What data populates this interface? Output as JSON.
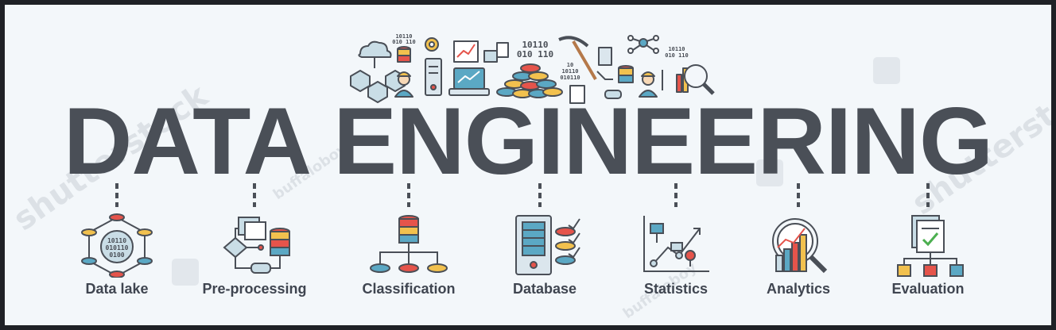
{
  "banner": {
    "title": "DATA ENGINEERING",
    "colors": {
      "title": "#4a4f57",
      "outline": "#4a4f57",
      "red": "#e5544b",
      "yellow": "#f2c14e",
      "teal": "#5ba8c4",
      "light_blue": "#c9dde6",
      "background": "#f3f7fa"
    },
    "items": [
      {
        "label": "Data lake",
        "icon": "data-lake-icon"
      },
      {
        "label": "Pre-processing",
        "icon": "pre-processing-icon"
      },
      {
        "label": "Classification",
        "icon": "classification-icon"
      },
      {
        "label": "Database",
        "icon": "database-icon"
      },
      {
        "label": "Statistics",
        "icon": "statistics-icon"
      },
      {
        "label": "Analytics",
        "icon": "analytics-icon"
      },
      {
        "label": "Evaluation",
        "icon": "evaluation-icon"
      }
    ],
    "hero_text": {
      "binary_small_1": "10110",
      "binary_small_2": "010 110",
      "binary_big_1": "10110",
      "binary_big_2": "010 110",
      "binary_mid_1": "10",
      "binary_mid_2": "10110",
      "binary_mid_3": "010110",
      "binary_right_1": "10110",
      "binary_right_2": "010 110",
      "lake_1": "10110",
      "lake_2": "010110",
      "lake_3": "0100"
    },
    "watermark": {
      "brand": "shutterstock",
      "author": "buffaloboy"
    }
  }
}
